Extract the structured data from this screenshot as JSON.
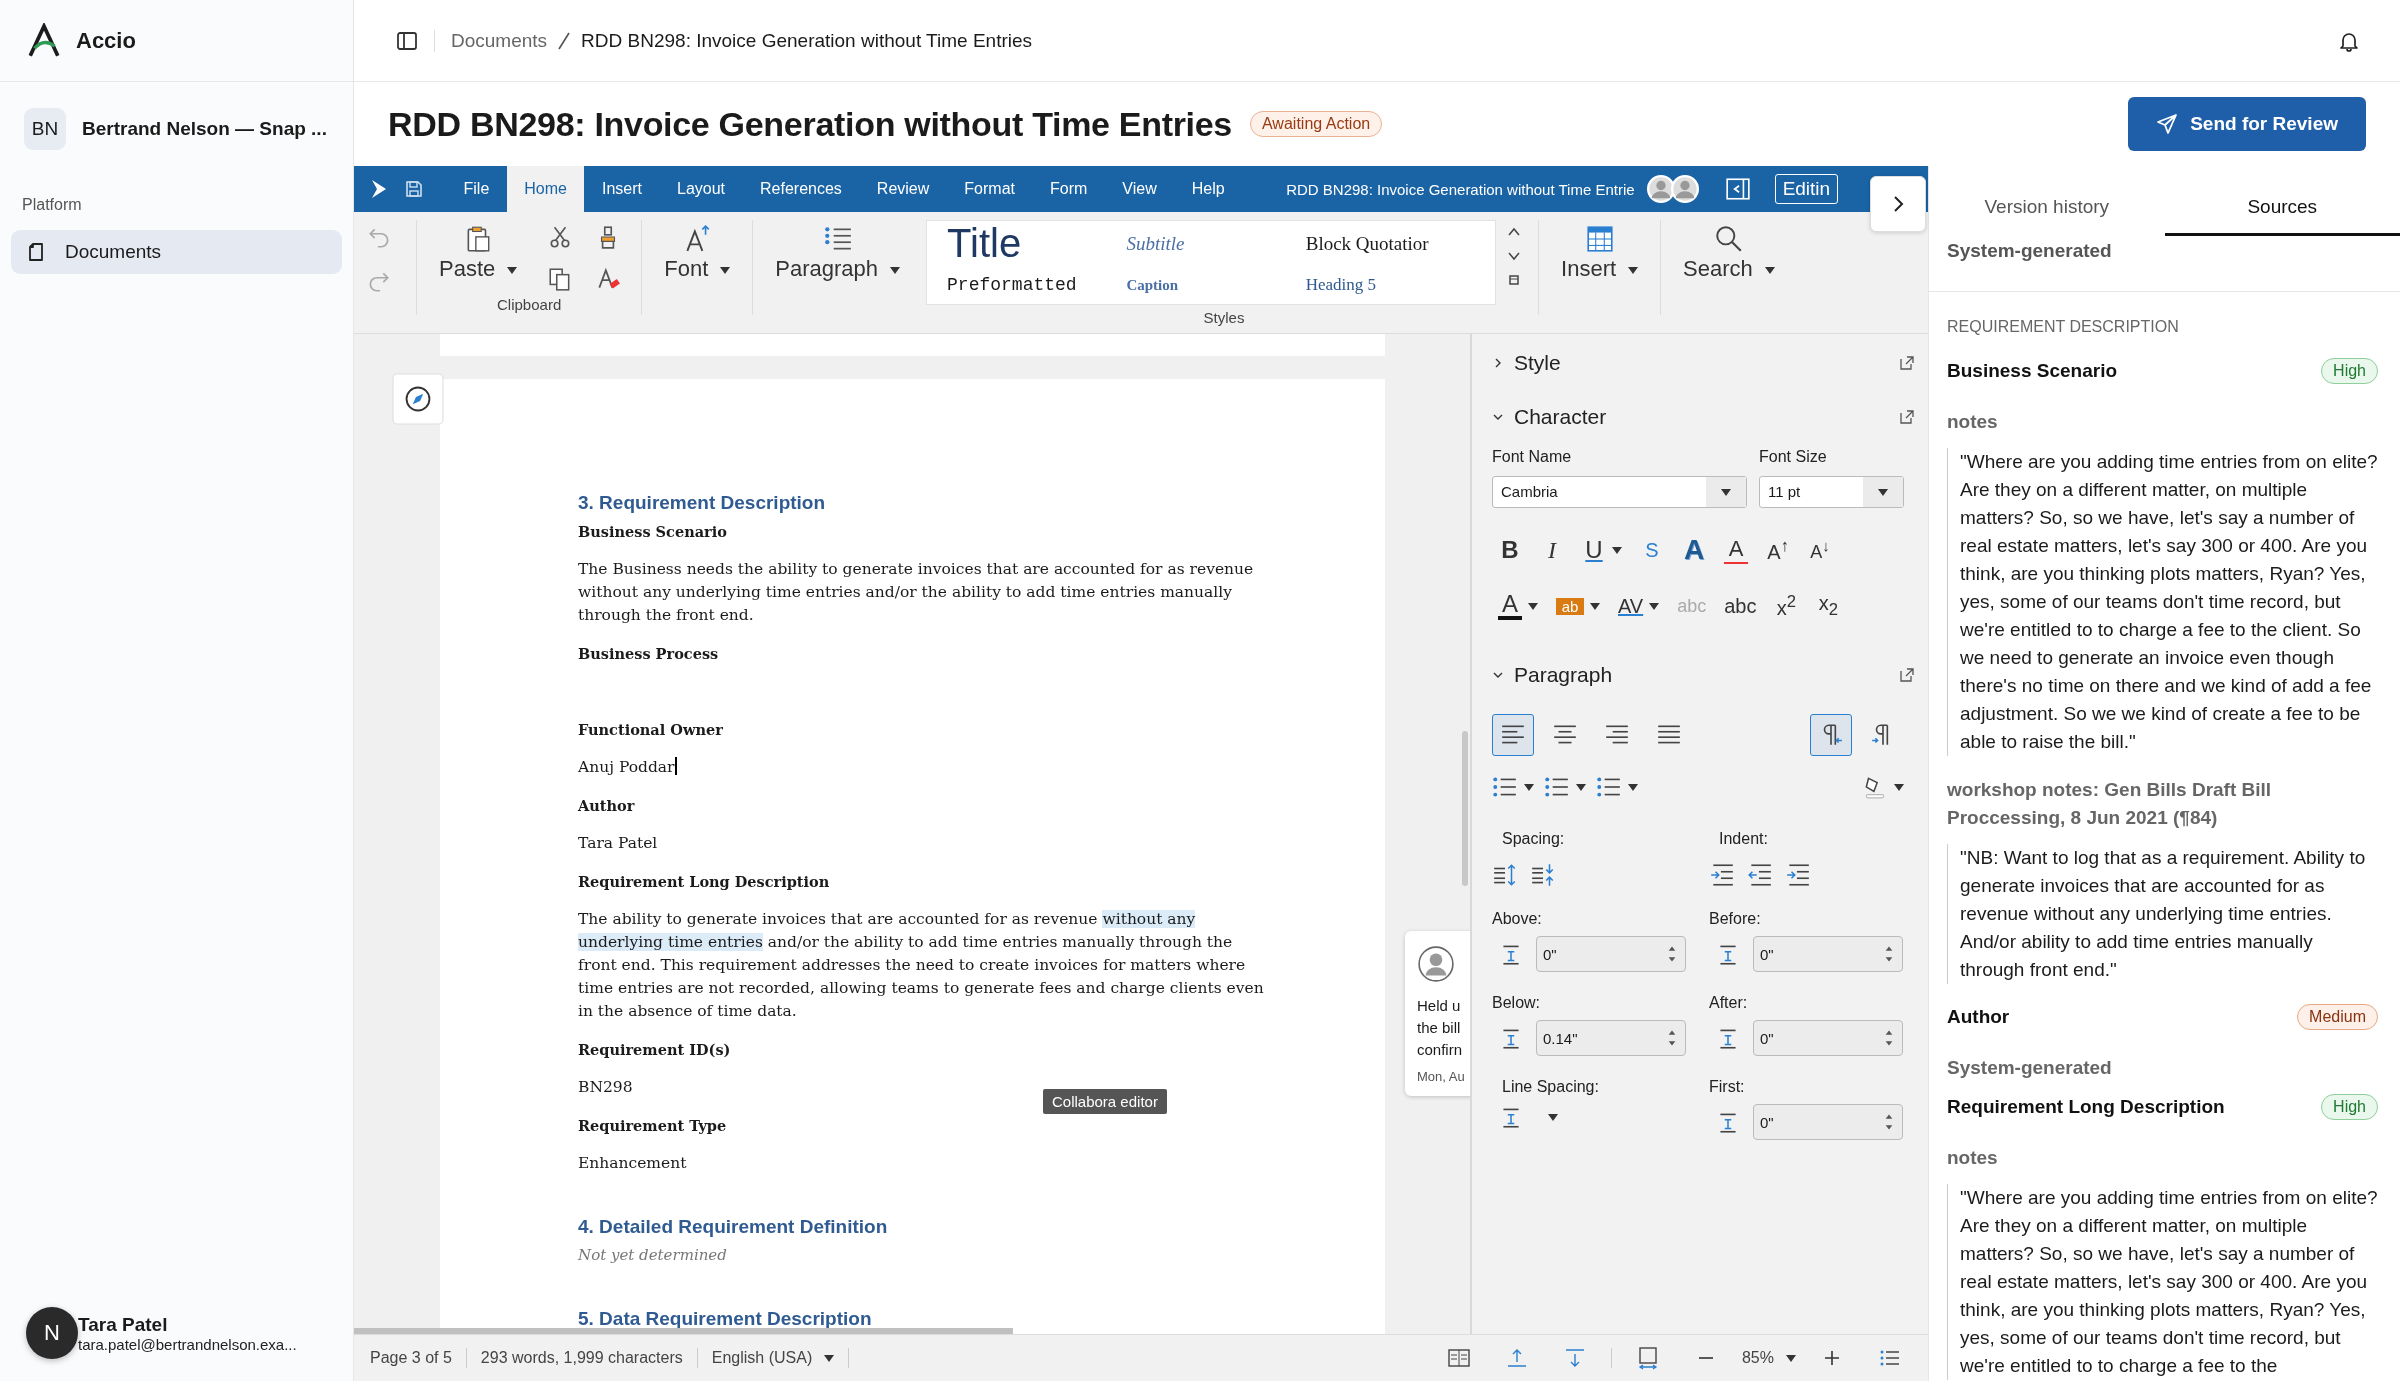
{
  "app": {
    "name": "Accio"
  },
  "workspace": {
    "initials": "BN",
    "name": "Bertrand Nelson — Snap ..."
  },
  "sidebar": {
    "section": "Platform",
    "items": [
      {
        "label": "Documents",
        "selected": true
      }
    ]
  },
  "user": {
    "initial": "N",
    "name": "Tara Patel",
    "email": "tara.patel@bertrandnelson.exa..."
  },
  "breadcrumb": [
    "Documents",
    "RDD BN298: Invoice Generation without Time Entries"
  ],
  "header": {
    "title": "RDD BN298: Invoice Generation without Time Entries",
    "status": "Awaiting Action",
    "action": "Send for Review"
  },
  "editor": {
    "menu": [
      {
        "label": "File",
        "selected": false
      },
      {
        "label": "Home",
        "selected": true
      },
      {
        "label": "Insert",
        "selected": false
      },
      {
        "label": "Layout",
        "selected": false
      },
      {
        "label": "References",
        "selected": false
      },
      {
        "label": "Review",
        "selected": false
      },
      {
        "label": "Format",
        "selected": false
      },
      {
        "label": "Form",
        "selected": false
      },
      {
        "label": "View",
        "selected": false
      },
      {
        "label": "Help",
        "selected": false
      }
    ],
    "doc_title": "RDD BN298: Invoice Generation without Time Entrie",
    "mode": "Editin",
    "ribbon": {
      "paste": "Paste",
      "clipboard": "Clipboard",
      "font": "Font",
      "paragraph": "Paragraph",
      "styles_label": "Styles",
      "insert": "Insert",
      "search": "Search",
      "styles": [
        {
          "label": "Title",
          "kind": "title"
        },
        {
          "label": "Subtitle",
          "kind": "subtitle"
        },
        {
          "label": "Block Quotatior",
          "kind": "quotation"
        },
        {
          "label": "Preformatted",
          "kind": "preformatted"
        },
        {
          "label": "Caption",
          "kind": "caption"
        },
        {
          "label": "Heading 5",
          "kind": "heading5"
        }
      ]
    },
    "document": [
      {
        "kind": "heading",
        "text": "3. Requirement Description"
      },
      {
        "kind": "label",
        "text": "Business Scenario"
      },
      {
        "kind": "para",
        "segments": [
          {
            "text": "The Business needs the ability to generate invoices that are accounted for as revenue without any underlying time entries and/or the ability to add time entries manually through the front end.",
            "highlighted": false
          }
        ]
      },
      {
        "kind": "label",
        "text": "Business Process"
      },
      {
        "kind": "blank"
      },
      {
        "kind": "label",
        "text": "Functional Owner"
      },
      {
        "kind": "para",
        "segments": [
          {
            "text": "Anuj Poddar",
            "highlighted": false
          }
        ],
        "cursor": true
      },
      {
        "kind": "label",
        "text": "Author"
      },
      {
        "kind": "para",
        "segments": [
          {
            "text": "Tara Patel",
            "highlighted": false
          }
        ]
      },
      {
        "kind": "label",
        "text": "Requirement Long Description"
      },
      {
        "kind": "para",
        "segments": [
          {
            "text": "The ability to generate invoices that are accounted for as revenue ",
            "highlighted": false
          },
          {
            "text": "without any underlying time entries",
            "highlighted": true
          },
          {
            "text": " and/or the ability to add time entries manually through the front end. This requirement addresses the need to create invoices for matters where time entries are not recorded, allowing teams to generate fees and charge clients even in the absence of time data.",
            "highlighted": false
          }
        ]
      },
      {
        "kind": "label",
        "text": "Requirement ID(s)"
      },
      {
        "kind": "para",
        "segments": [
          {
            "text": "BN298",
            "highlighted": false
          }
        ]
      },
      {
        "kind": "label",
        "text": "Requirement Type"
      },
      {
        "kind": "para",
        "segments": [
          {
            "text": "Enhancement",
            "highlighted": false
          }
        ]
      },
      {
        "kind": "heading",
        "text": "4. Detailed Requirement Definition"
      },
      {
        "kind": "note",
        "text": "Not yet determined"
      },
      {
        "kind": "heading",
        "text": "5. Data Requirement Description"
      }
    ],
    "tooltip": "Collabora editor",
    "comment": {
      "lines": [
        "Held u",
        "the bill",
        "confirn"
      ],
      "date": "Mon, Au"
    },
    "deck": {
      "sections": [
        {
          "label": "Style",
          "expanded": false
        },
        {
          "label": "Character",
          "expanded": true
        },
        {
          "label": "Paragraph",
          "expanded": true
        }
      ],
      "font_name_label": "Font Name",
      "font_name": "Cambria",
      "font_size_label": "Font Size",
      "font_size": "11 pt",
      "char_buttons": [
        {
          "glyph": "B",
          "kind": "bold",
          "dropdown": false
        },
        {
          "glyph": "I",
          "kind": "italic",
          "dropdown": false
        },
        {
          "glyph": "U",
          "kind": "underline",
          "dropdown": true
        },
        {
          "glyph": "S",
          "kind": "strike",
          "dropdown": false
        },
        {
          "glyph": "A",
          "kind": "shadow",
          "dropdown": false
        },
        {
          "glyph": "A",
          "kind": "clear",
          "dropdown": false
        },
        {
          "glyph": "A$^{↑}$",
          "kind": "plain",
          "dropdown": false
        },
        {
          "glyph": "A$^{↓}$",
          "kind": "small",
          "dropdown": false
        }
      ],
      "char_buttons2": [
        {
          "glyph": "A",
          "kind": "color",
          "dropdown": true
        },
        {
          "glyph": "ab",
          "kind": "highlight",
          "dropdown": true
        },
        {
          "glyph": "AV",
          "kind": "spacing",
          "dropdown": true
        },
        {
          "glyph": "abc",
          "kind": "disabled",
          "dropdown": false
        },
        {
          "glyph": "abc",
          "kind": "plain",
          "dropdown": false
        },
        {
          "glyph": "x$^{2}$",
          "kind": "plain",
          "dropdown": false
        },
        {
          "glyph": "x$_{2}$",
          "kind": "plain",
          "dropdown": false
        }
      ],
      "align": [
        {
          "selected": true
        },
        {
          "selected": false
        },
        {
          "selected": false
        },
        {
          "selected": false
        }
      ],
      "direction": [
        {
          "selected": true
        },
        {
          "selected": false
        }
      ],
      "spacing_label": "Spacing:",
      "indent_label": "Indent:",
      "fields": [
        {
          "label": "Above:",
          "value": "0\""
        },
        {
          "label": "Before:",
          "value": "0\""
        },
        {
          "label": "Below:",
          "value": "0.14\""
        },
        {
          "label": "After:",
          "value": "0\""
        },
        {
          "label": "Line Spacing:"
        },
        {
          "label": "First:",
          "value": "0\""
        }
      ]
    },
    "status": {
      "page": "Page 3 of 5",
      "words": "293 words, 1,999 characters",
      "language": "English (USA)",
      "zoom": "85%"
    }
  },
  "sources": {
    "tabs": [
      {
        "label": "Version history",
        "selected": false
      },
      {
        "label": "Sources",
        "selected": true
      }
    ],
    "top_note": "System-generated",
    "items": [
      {
        "kind": "section",
        "text": "REQUIREMENT DESCRIPTION"
      },
      {
        "kind": "field",
        "text": "Business Scenario",
        "badge": {
          "label": "High",
          "kind": "high"
        }
      },
      {
        "kind": "source",
        "text": "notes"
      },
      {
        "kind": "quote",
        "text": "\"Where are you adding time entries from on elite? Are they on a different matter, on multiple matters? So, so we have, let's say a number of real estate matters, let's say 300 or 400. Are you think, are you thinking plots matters, Ryan? Yes, yes, some of our teams don't time record, but we're entitled to to charge a fee to the client. So we need to generate an invoice even though there's no time on there and we kind of add a fee adjustment. So we we kind of create a fee to be able to raise the bill.\""
      },
      {
        "kind": "source",
        "text": "workshop notes: Gen Bills Draft Bill Proccessing, 8 Jun 2021 (¶84)"
      },
      {
        "kind": "quote",
        "text": "\"NB: Want to log that as a requirement. Ability to generate invoices that are accounted for as revenue without any underlying time entries. And/or ability to add time entries manually through front end.\""
      },
      {
        "kind": "field",
        "text": "Author",
        "badge": {
          "label": "Medium",
          "kind": "medium"
        }
      },
      {
        "kind": "source",
        "text": "System-generated"
      },
      {
        "kind": "field",
        "text": "Requirement Long Description",
        "badge": {
          "label": "High",
          "kind": "high"
        }
      },
      {
        "kind": "source",
        "text": "notes"
      },
      {
        "kind": "quote",
        "text": "\"Where are you adding time entries from on elite? Are they on a different matter, on multiple matters? So, so we have, let's say a number of real estate matters, let's say 300 or 400. Are you think, are you thinking plots matters, Ryan? Yes, yes, some of our teams don't time record, but we're entitled to to charge a fee to the"
      }
    ]
  }
}
